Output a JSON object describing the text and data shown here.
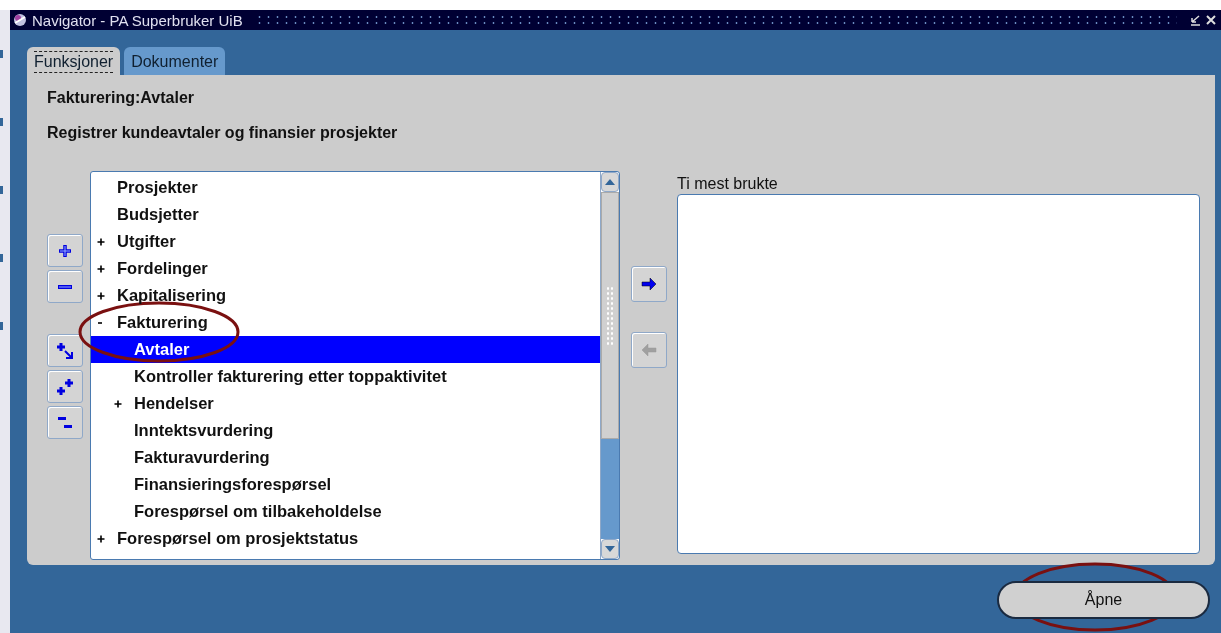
{
  "window": {
    "title": "Navigator - PA Superbruker UiB"
  },
  "tabs": [
    {
      "label": "Funksjoner",
      "selected": true
    },
    {
      "label": "Dokumenter",
      "selected": false
    }
  ],
  "heading": "Fakturering:Avtaler",
  "description": "Registrer kundeavtaler og finansier prosjekter",
  "tree_buttons": [
    {
      "kind": "expand"
    },
    {
      "kind": "collapse"
    },
    {
      "kind": "expand_branch"
    },
    {
      "kind": "expand_all"
    },
    {
      "kind": "collapse_all"
    }
  ],
  "tree": [
    {
      "label": "Prosjekter",
      "selected": false
    },
    {
      "label": "Budsjetter",
      "selected": false
    },
    {
      "label": "Utgifter",
      "selected": false,
      "expanded": false
    },
    {
      "label": "Fordelinger",
      "selected": false,
      "expanded": false
    },
    {
      "label": "Kapitalisering",
      "selected": false,
      "expanded": false
    },
    {
      "label": "Fakturering",
      "selected": false,
      "expanded": true,
      "children": [
        {
          "label": "Avtaler",
          "selected": true
        },
        {
          "label": "Kontroller fakturering etter toppaktivitet",
          "selected": false
        },
        {
          "label": "Hendelser",
          "selected": false,
          "expanded": false
        },
        {
          "label": "Inntektsvurdering",
          "selected": false
        },
        {
          "label": "Fakturavurdering",
          "selected": false
        },
        {
          "label": "Finansieringsforespørsel",
          "selected": false
        },
        {
          "label": "Forespørsel om tilbakeholdelse",
          "selected": false
        }
      ]
    },
    {
      "label": "Forespørsel om prosjektstatus",
      "selected": false,
      "expanded": false
    }
  ],
  "transfer_buttons": [
    {
      "kind": "add",
      "disabled": false
    },
    {
      "kind": "remove",
      "disabled": true
    }
  ],
  "favorites": {
    "label": "Ti mest brukte"
  },
  "open_button": {
    "label": "Åpne"
  }
}
